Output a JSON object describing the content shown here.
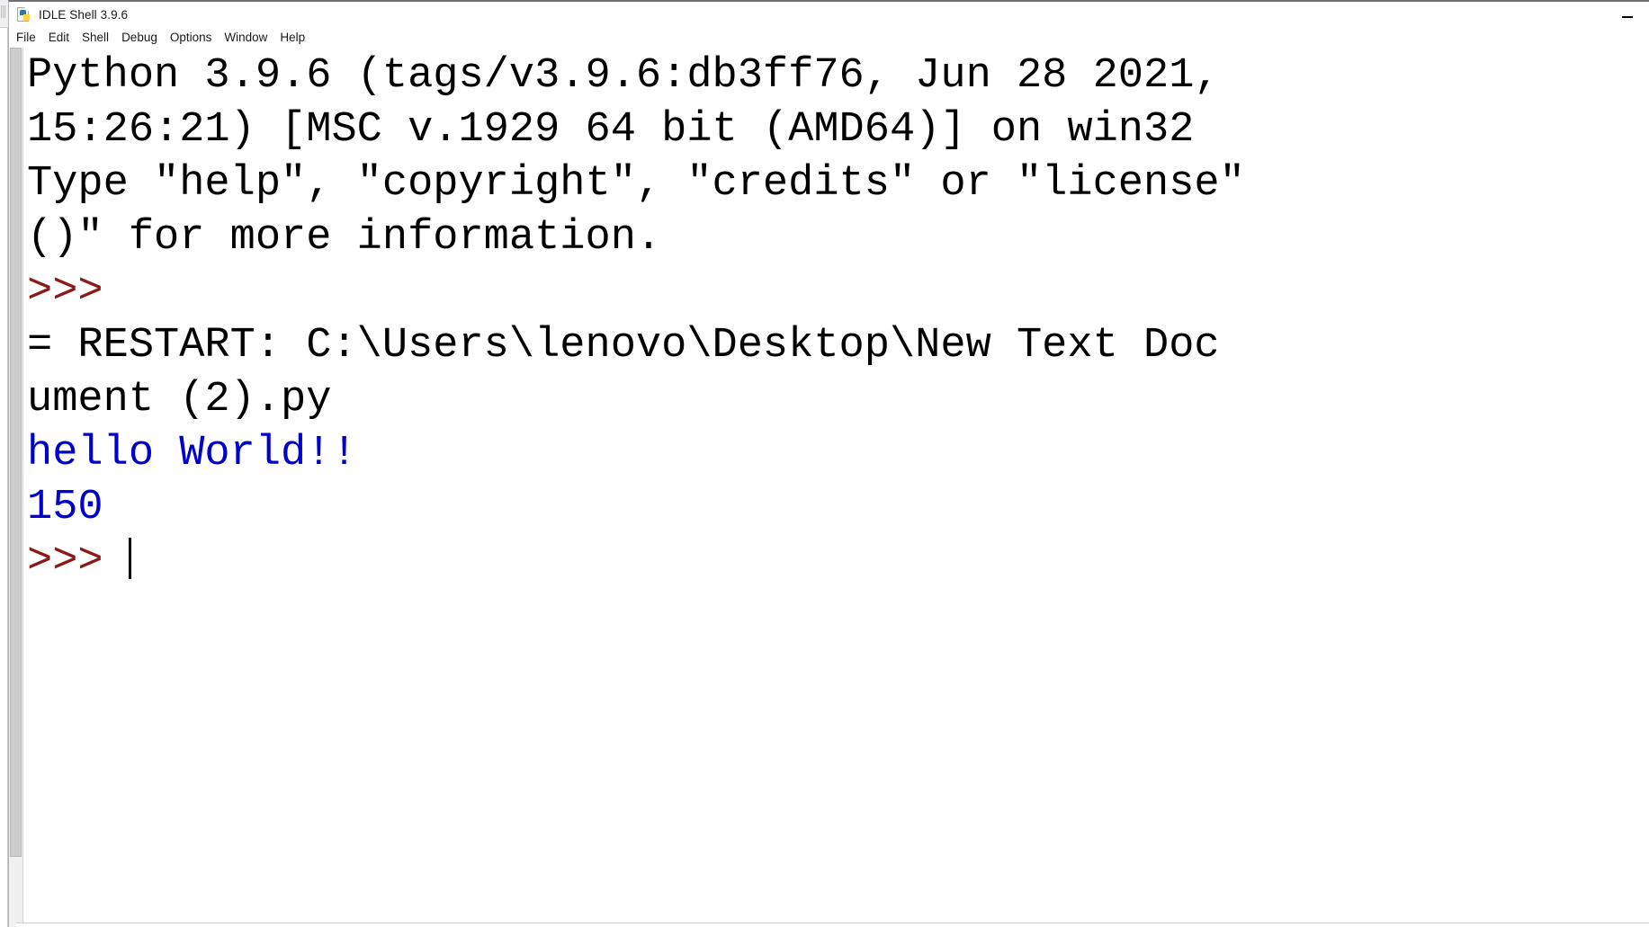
{
  "window": {
    "title": "IDLE Shell 3.9.6",
    "icon": "idle-python-document-icon",
    "controls": {
      "minimize_label": "—"
    }
  },
  "menubar": {
    "items": [
      {
        "label": "File"
      },
      {
        "label": "Edit"
      },
      {
        "label": "Shell"
      },
      {
        "label": "Debug"
      },
      {
        "label": "Options"
      },
      {
        "label": "Window"
      },
      {
        "label": "Help"
      }
    ]
  },
  "shell": {
    "lines": [
      {
        "text": "Python 3.9.6 (tags/v3.9.6:db3ff76, Jun 28 2021,",
        "kind": "banner"
      },
      {
        "text": "15:26:21) [MSC v.1929 64 bit (AMD64)] on win32",
        "kind": "banner"
      },
      {
        "text": "Type \"help\", \"copyright\", \"credits\" or \"license\"",
        "kind": "banner"
      },
      {
        "text": "()\" for more information.",
        "kind": "banner"
      },
      {
        "text": ">>> ",
        "kind": "prompt"
      },
      {
        "text": "= RESTART: C:\\Users\\lenovo\\Desktop\\New Text Doc",
        "kind": "restart"
      },
      {
        "text": "ument (2).py",
        "kind": "restart"
      },
      {
        "text": "hello World!!",
        "kind": "stdout"
      },
      {
        "text": "150",
        "kind": "stdout"
      },
      {
        "text": ">>> ",
        "kind": "prompt-cursor"
      }
    ],
    "colors": {
      "banner_text": "#000000",
      "stdout_text": "#0000cc",
      "prompt_text": "#8b1a1a",
      "background": "#ffffff",
      "cursor": "#000000"
    }
  }
}
